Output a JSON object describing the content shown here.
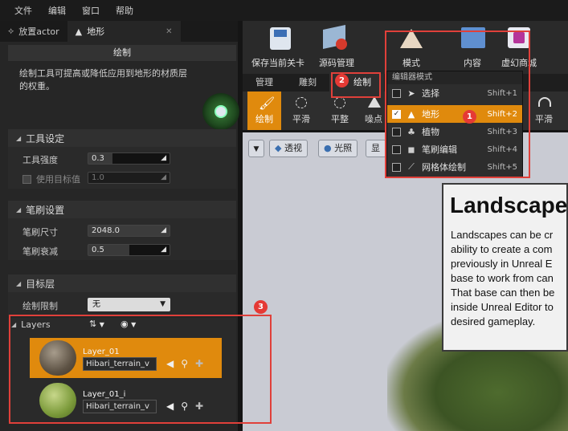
{
  "menu": [
    "文件",
    "编辑",
    "窗口",
    "帮助"
  ],
  "tabs": [
    {
      "label": "放置actor"
    },
    {
      "label": "地形"
    }
  ],
  "panel": {
    "paint_header": "绘制",
    "description_line1": "绘制工具可提高或降低应用到地形的材质层",
    "description_line2": "的权重。",
    "tool_settings": {
      "title": "工具设定",
      "strength_label": "工具强度",
      "strength_value": "0.3",
      "strength_fraction": 0.3,
      "use_target_label": "使用目标值",
      "use_target_value": "1.0"
    },
    "brush_settings": {
      "title": "笔刷设置",
      "size_label": "笔刷尺寸",
      "size_value": "2048.0",
      "falloff_label": "笔刷衰减",
      "falloff_value": "0.5",
      "falloff_fraction": 0.5
    },
    "target_layers": {
      "title": "目标层",
      "limit_label": "绘制限制",
      "limit_value": "无",
      "layers_label": "Layers",
      "layers": [
        {
          "name": "Layer_01",
          "material": "Hibari_terrain_v",
          "selected": true
        },
        {
          "name": "Layer_01_i",
          "material": "Hibari_terrain_v",
          "selected": false
        }
      ]
    }
  },
  "toolbar": {
    "save_label": "保存当前关卡",
    "source_label": "源码管理",
    "modes_label": "模式",
    "content_label": "内容",
    "market_label": "虚幻商城"
  },
  "mode_tabs": [
    "管理",
    "雕刻",
    "绘制"
  ],
  "tools": [
    {
      "label": "绘制",
      "active": true
    },
    {
      "label": "平滑",
      "active": false
    },
    {
      "label": "平整",
      "active": false
    },
    {
      "label": "噪点",
      "active": false
    },
    {
      "label": "平滑",
      "active": false
    }
  ],
  "viewport_buttons": [
    "透视",
    "光照",
    "显示"
  ],
  "dropdown": {
    "header": "编辑器模式",
    "items": [
      {
        "label": "选择",
        "shortcut": "Shift+1",
        "checked": false,
        "active": false
      },
      {
        "label": "地形",
        "shortcut": "Shift+2",
        "checked": true,
        "active": true
      },
      {
        "label": "植物",
        "shortcut": "Shift+3",
        "checked": false,
        "active": false
      },
      {
        "label": "笔刷编辑",
        "shortcut": "Shift+4",
        "checked": false,
        "active": false
      },
      {
        "label": "网格体绘制",
        "shortcut": "Shift+5",
        "checked": false,
        "active": false
      }
    ]
  },
  "tooltip": {
    "title": "Landscapes",
    "body": "Landscapes can be cr\nability to create a com\npreviously in Unreal E\nbase to work from can\nThat base can then be\ninside Unreal Editor to\ndesired gameplay."
  },
  "badges": [
    "1",
    "2",
    "3"
  ],
  "colors": {
    "accent": "#e08a0d",
    "annotation": "#e0403a"
  }
}
